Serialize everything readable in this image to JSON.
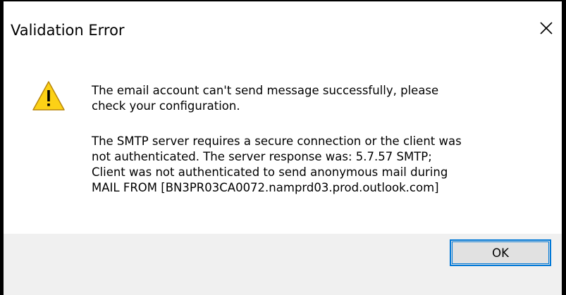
{
  "dialog": {
    "title": "Validation Error",
    "close_icon": "close-icon",
    "warning_icon": "warning-icon",
    "message_summary": "The email account can't send message successfully, please check your configuration.",
    "message_detail": "The SMTP server requires a secure connection or the client was not authenticated. The server response was: 5.7.57 SMTP; Client was not authenticated to send anonymous mail during MAIL FROM [BN3PR03CA0072.namprd03.prod.outlook.com]",
    "ok_label": "OK"
  },
  "colors": {
    "warning_fill": "#fcd116",
    "warning_outline": "#b8860b",
    "button_focus": "#0078d7",
    "footer_bg": "#f0f0f0"
  }
}
